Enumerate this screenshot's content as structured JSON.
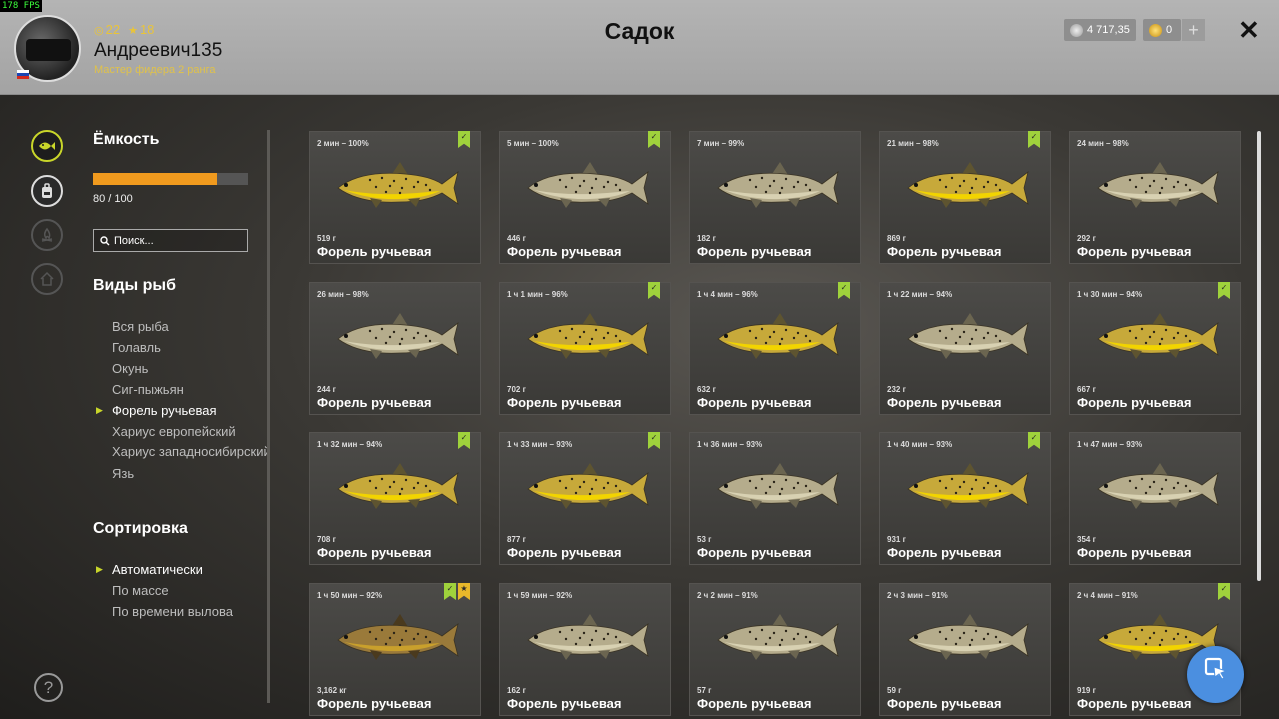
{
  "fps": "178 FPS",
  "header": {
    "title": "Садок",
    "username": "Андреевич135",
    "rank": "Мастер фидера 2 ранга",
    "level": "22",
    "stars": "18",
    "silver": "4 717,35",
    "gold": "0",
    "plus": "+",
    "close": "✕"
  },
  "sidebar": {
    "capacity_title": "Ёмкость",
    "capacity_text": "80 / 100",
    "capacity_fraction": 0.8,
    "search_placeholder": "Поиск...",
    "species_title": "Виды рыб",
    "species": [
      "Вся рыба",
      "Голавль",
      "Окунь",
      "Сиг-пыжьян",
      "Форель ручьевая",
      "Хариус европейский",
      "Хариус западносибирский",
      "Язь"
    ],
    "species_active": 4,
    "sort_title": "Сортировка",
    "sort": [
      "Автоматически",
      "По массе",
      "По времени вылова"
    ],
    "sort_active": 0
  },
  "fish": [
    {
      "time": "2 мин – 100%",
      "weight": "519 г",
      "name": "Форель ручьевая",
      "check": true,
      "star": false,
      "tone": "yellow"
    },
    {
      "time": "5 мин – 100%",
      "weight": "446 г",
      "name": "Форель ручьевая",
      "check": true,
      "star": false,
      "tone": "pale"
    },
    {
      "time": "7 мин – 99%",
      "weight": "182 г",
      "name": "Форель ручьевая",
      "check": false,
      "star": false,
      "tone": "pale"
    },
    {
      "time": "21 мин – 98%",
      "weight": "869 г",
      "name": "Форель ручьевая",
      "check": true,
      "star": false,
      "tone": "yellow"
    },
    {
      "time": "24 мин – 98%",
      "weight": "292 г",
      "name": "Форель ручьевая",
      "check": false,
      "star": false,
      "tone": "pale"
    },
    {
      "time": "26 мин – 98%",
      "weight": "244 г",
      "name": "Форель ручьевая",
      "check": false,
      "star": false,
      "tone": "pale"
    },
    {
      "time": "1 ч 1 мин – 96%",
      "weight": "702 г",
      "name": "Форель ручьевая",
      "check": true,
      "star": false,
      "tone": "yellow"
    },
    {
      "time": "1 ч 4 мин – 96%",
      "weight": "632 г",
      "name": "Форель ручьевая",
      "check": true,
      "star": false,
      "tone": "yellow"
    },
    {
      "time": "1 ч 22 мин – 94%",
      "weight": "232 г",
      "name": "Форель ручьевая",
      "check": false,
      "star": false,
      "tone": "pale"
    },
    {
      "time": "1 ч 30 мин – 94%",
      "weight": "667 г",
      "name": "Форель ручьевая",
      "check": true,
      "star": false,
      "tone": "yellow"
    },
    {
      "time": "1 ч 32 мин – 94%",
      "weight": "708 г",
      "name": "Форель ручьевая",
      "check": true,
      "star": false,
      "tone": "yellow"
    },
    {
      "time": "1 ч 33 мин – 93%",
      "weight": "877 г",
      "name": "Форель ручьевая",
      "check": true,
      "star": false,
      "tone": "yellow"
    },
    {
      "time": "1 ч 36 мин – 93%",
      "weight": "53 г",
      "name": "Форель ручьевая",
      "check": false,
      "star": false,
      "tone": "pale"
    },
    {
      "time": "1 ч 40 мин – 93%",
      "weight": "931 г",
      "name": "Форель ручьевая",
      "check": true,
      "star": false,
      "tone": "yellow"
    },
    {
      "time": "1 ч 47 мин – 93%",
      "weight": "354 г",
      "name": "Форель ручьевая",
      "check": false,
      "star": false,
      "tone": "pale"
    },
    {
      "time": "1 ч 50 мин – 92%",
      "weight": "3,162 кг",
      "name": "Форель ручьевая",
      "check": true,
      "star": true,
      "tone": "brown"
    },
    {
      "time": "1 ч 59 мин – 92%",
      "weight": "162 г",
      "name": "Форель ручьевая",
      "check": false,
      "star": false,
      "tone": "pale"
    },
    {
      "time": "2 ч 2 мин – 91%",
      "weight": "57 г",
      "name": "Форель ручьевая",
      "check": false,
      "star": false,
      "tone": "pale"
    },
    {
      "time": "2 ч 3 мин – 91%",
      "weight": "59 г",
      "name": "Форель ручьевая",
      "check": false,
      "star": false,
      "tone": "pale"
    },
    {
      "time": "2 ч 4 мин – 91%",
      "weight": "919 г",
      "name": "Форель ручьевая",
      "check": true,
      "star": false,
      "tone": "yellow"
    }
  ],
  "colors": {
    "accent": "#c9d62a",
    "progress": "#f09a1e",
    "check_badge": "#9fd23c",
    "star_badge": "#e8b82a",
    "fab": "#4b8fe0"
  },
  "icons": {
    "rail": [
      "fish-icon",
      "backpack-icon",
      "campfire-icon",
      "home-icon"
    ],
    "help": "?",
    "fab": "cursor-icon"
  }
}
